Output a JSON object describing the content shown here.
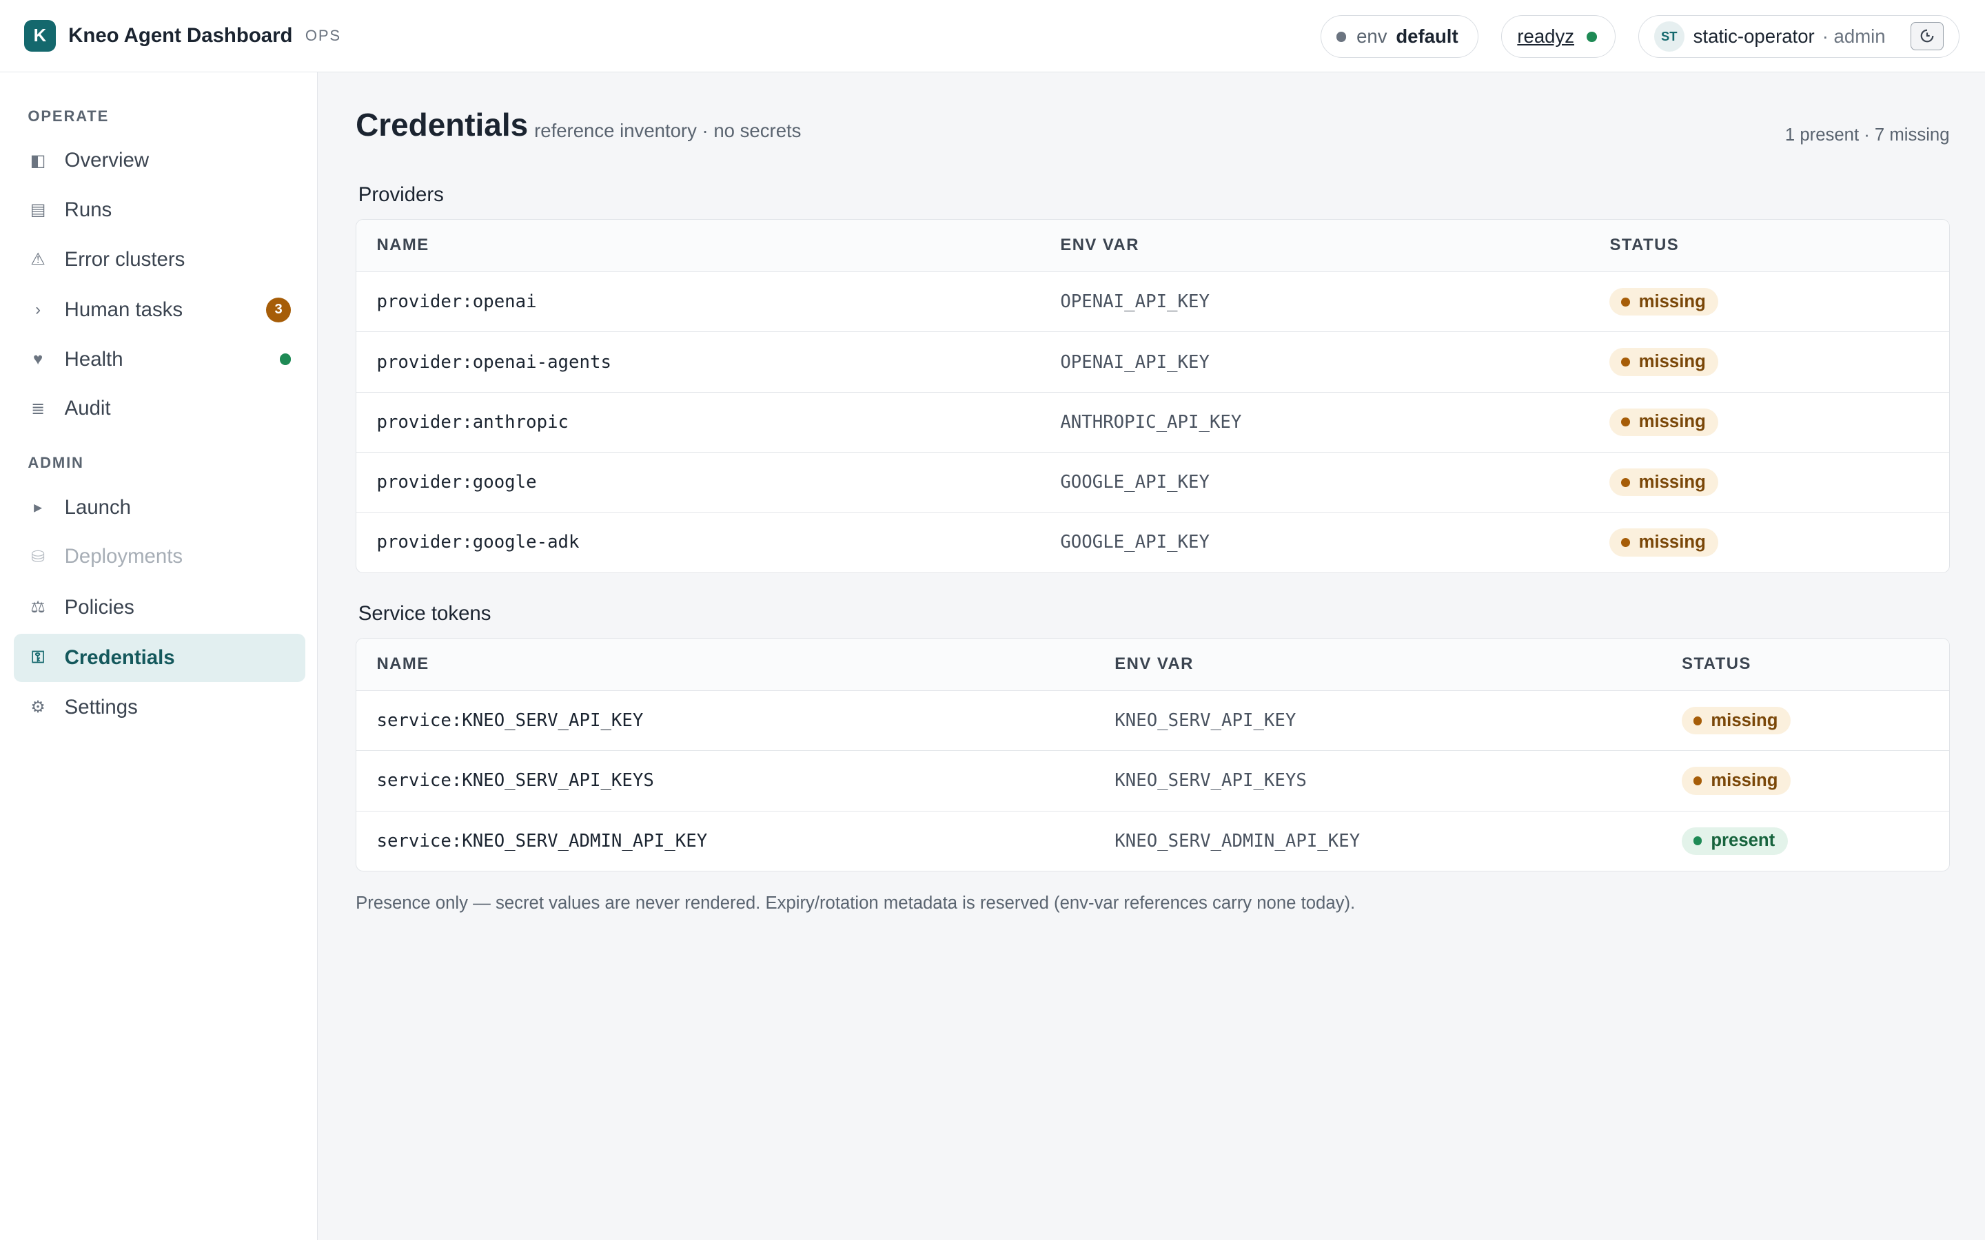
{
  "header": {
    "logo_letter": "K",
    "title": "Kneo Agent Dashboard",
    "tag": "OPS",
    "env_label": "env",
    "env_value": "default",
    "ready_label": "readyz",
    "ready_status_color": "#1e8a55",
    "user_initials": "ST",
    "user_name": "static-operator",
    "user_role": "· admin",
    "signout_icon": "sign-out-icon"
  },
  "sidebar": {
    "operate_label": "OPERATE",
    "admin_label": "ADMIN",
    "items": [
      {
        "label": "Overview",
        "icon": "overview-icon",
        "glyph": "◧"
      },
      {
        "label": "Runs",
        "icon": "runs-icon",
        "glyph": "▤"
      },
      {
        "label": "Error clusters",
        "icon": "warning-icon",
        "glyph": "⚠"
      },
      {
        "label": "Human tasks",
        "icon": "chevron-right-icon",
        "glyph": "›",
        "badge": "3"
      },
      {
        "label": "Health",
        "icon": "heart-icon",
        "glyph": "♥"
      },
      {
        "label": "Audit",
        "icon": "audit-icon",
        "glyph": "≣"
      },
      {
        "label": "Launch",
        "icon": "play-icon",
        "glyph": "▸"
      },
      {
        "label": "Deployments",
        "icon": "database-icon",
        "glyph": "⛁"
      },
      {
        "label": "Policies",
        "icon": "scales-icon",
        "glyph": "⚖"
      },
      {
        "label": "Credentials",
        "icon": "key-icon",
        "glyph": "⚿"
      },
      {
        "label": "Settings",
        "icon": "gear-icon",
        "glyph": "⚙"
      }
    ],
    "active_item": "Credentials",
    "disabled_item": "Deployments"
  },
  "main": {
    "title": "Credentials",
    "subtitle": "reference inventory · no secrets",
    "summary": "1 present · 7 missing",
    "columns": {
      "name": "NAME",
      "env": "ENV VAR",
      "status": "STATUS"
    },
    "providers_title": "Providers",
    "providers": [
      {
        "name": "provider:openai",
        "env": "OPENAI_API_KEY",
        "status": "missing"
      },
      {
        "name": "provider:openai-agents",
        "env": "OPENAI_API_KEY",
        "status": "missing"
      },
      {
        "name": "provider:anthropic",
        "env": "ANTHROPIC_API_KEY",
        "status": "missing"
      },
      {
        "name": "provider:google",
        "env": "GOOGLE_API_KEY",
        "status": "missing"
      },
      {
        "name": "provider:google-adk",
        "env": "GOOGLE_API_KEY",
        "status": "missing"
      }
    ],
    "services_title": "Service tokens",
    "services": [
      {
        "name": "service:KNEO_SERV_API_KEY",
        "env": "KNEO_SERV_API_KEY",
        "status": "missing"
      },
      {
        "name": "service:KNEO_SERV_API_KEYS",
        "env": "KNEO_SERV_API_KEYS",
        "status": "missing"
      },
      {
        "name": "service:KNEO_SERV_ADMIN_API_KEY",
        "env": "KNEO_SERV_ADMIN_API_KEY",
        "status": "present"
      }
    ],
    "footnote": "Presence only — secret values are never rendered. Expiry/rotation metadata is reserved (env-var references carry none today)."
  },
  "colors": {
    "accent": "#14686d",
    "missing": "#a65d08",
    "present": "#1e8a55"
  }
}
